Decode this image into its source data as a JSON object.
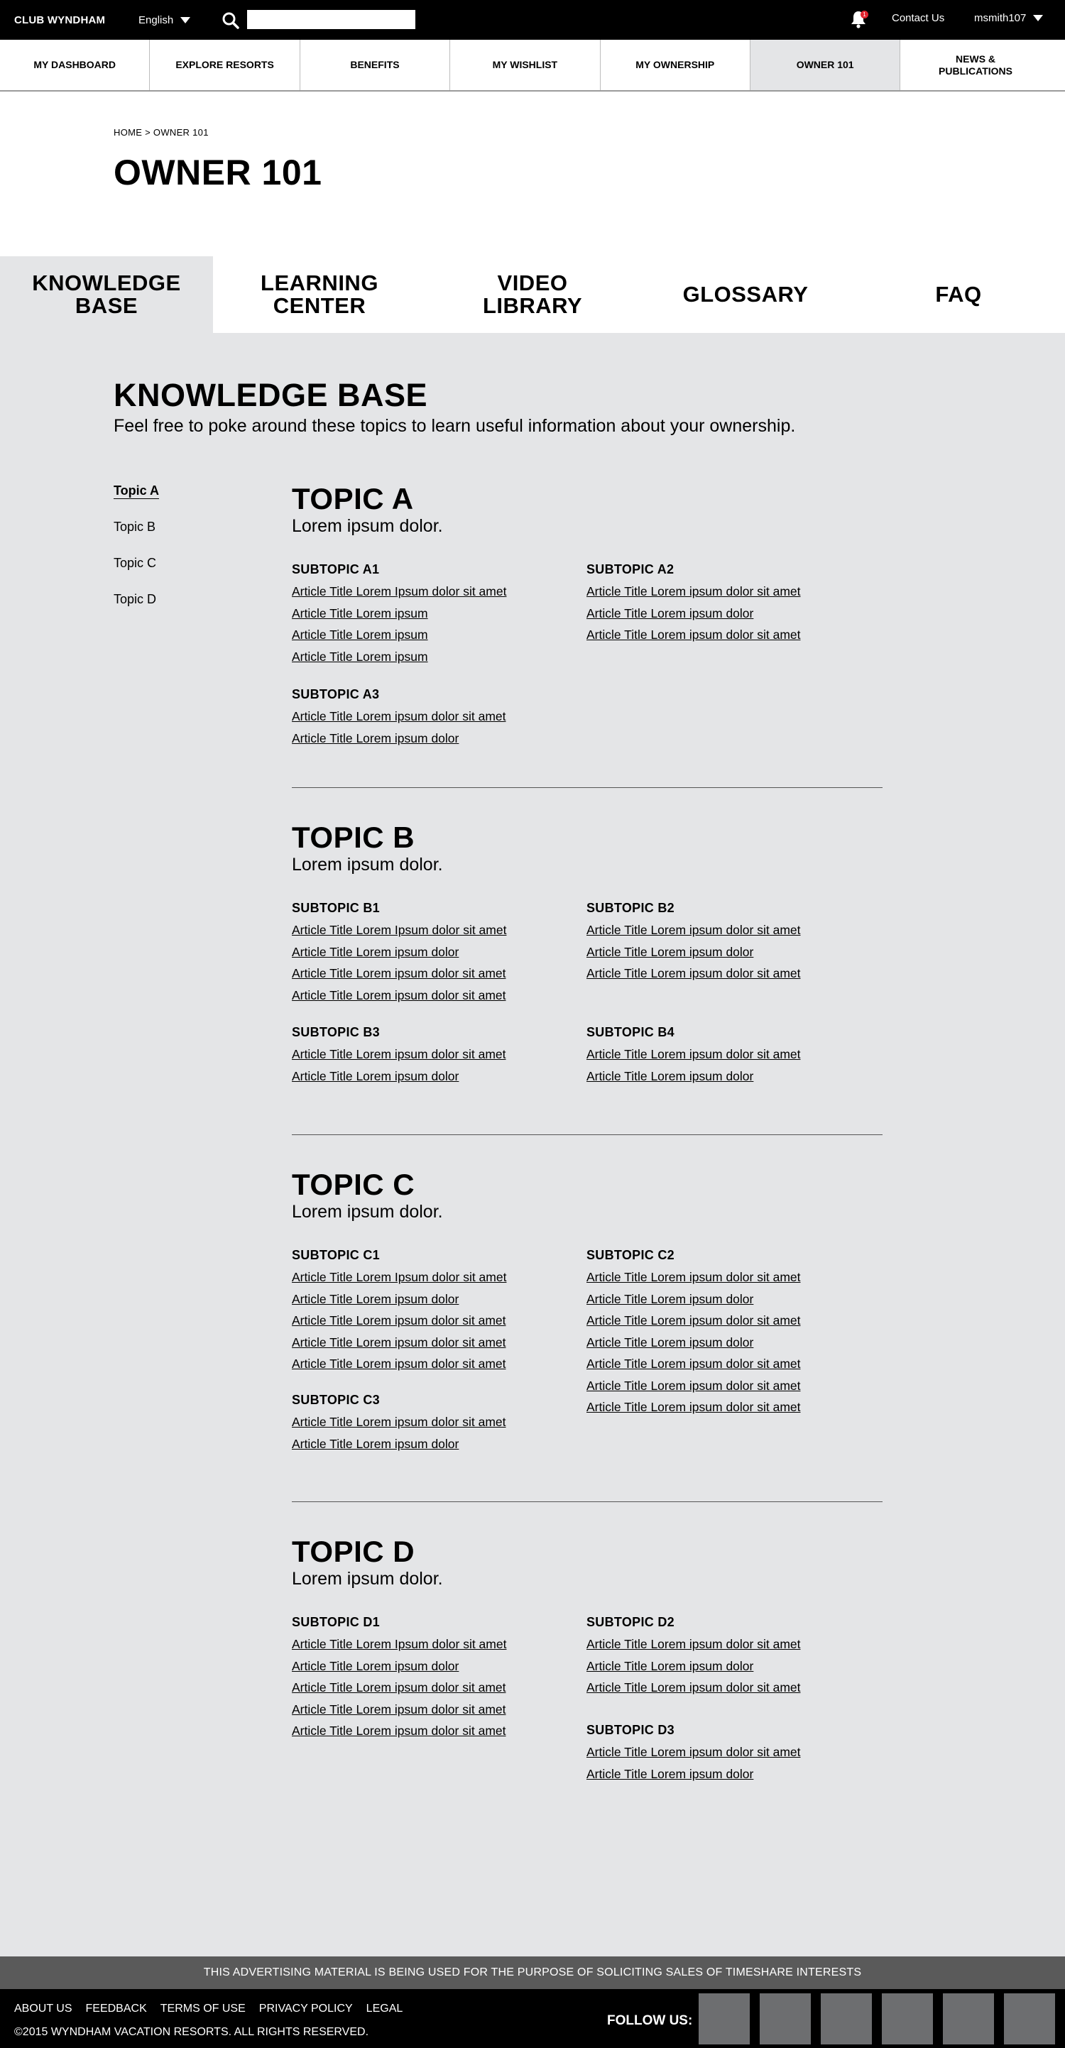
{
  "topbar": {
    "brand": "CLUB WYNDHAM",
    "language": "English",
    "search_placeholder": "",
    "notification_count": "1",
    "contact": "Contact Us",
    "username": "msmith107"
  },
  "mainnav": [
    {
      "label": "MY DASHBOARD"
    },
    {
      "label": "EXPLORE RESORTS"
    },
    {
      "label": "BENEFITS"
    },
    {
      "label": "MY WISHLIST"
    },
    {
      "label": "MY OWNERSHIP"
    },
    {
      "label": "OWNER 101"
    },
    {
      "label": "NEWS & PUBLICATIONS"
    }
  ],
  "breadcrumb": "HOME > OWNER 101",
  "page_title": "OWNER 101",
  "tabs": [
    {
      "label": "KNOWLEDGE BASE"
    },
    {
      "label": "LEARNING CENTER"
    },
    {
      "label": "VIDEO LIBRARY"
    },
    {
      "label": "GLOSSARY"
    },
    {
      "label": "FAQ"
    }
  ],
  "kb": {
    "title": "KNOWLEDGE BASE",
    "subtitle": "Feel free to poke around these topics to learn useful information about your ownership."
  },
  "sidenav": [
    "Topic A",
    "Topic B",
    "Topic C",
    "Topic D"
  ],
  "topics": [
    {
      "title": "TOPIC A",
      "subtitle": "Lorem ipsum dolor.",
      "subtopics": [
        {
          "title": "SUBTOPIC A1",
          "links": [
            "Article Title Lorem Ipsum dolor sit amet",
            "Article Title Lorem ipsum",
            "Article Title Lorem ipsum",
            "Article Title Lorem ipsum"
          ]
        },
        {
          "title": "SUBTOPIC A2",
          "links": [
            "Article Title Lorem ipsum dolor sit amet",
            "Article Title Lorem ipsum dolor",
            "Article Title Lorem ipsum dolor sit amet"
          ]
        },
        {
          "title": "SUBTOPIC A3",
          "links": [
            "Article Title Lorem ipsum dolor sit amet",
            "Article Title Lorem ipsum dolor"
          ]
        }
      ]
    },
    {
      "title": "TOPIC B",
      "subtitle": "Lorem ipsum dolor.",
      "subtopics": [
        {
          "title": "SUBTOPIC B1",
          "links": [
            "Article Title Lorem Ipsum dolor sit amet",
            "Article Title Lorem ipsum dolor",
            "Article Title Lorem ipsum dolor sit amet",
            "Article Title Lorem ipsum dolor sit amet"
          ]
        },
        {
          "title": "SUBTOPIC B2",
          "links": [
            "Article Title Lorem ipsum dolor sit amet",
            "Article Title Lorem ipsum dolor",
            "Article Title Lorem ipsum dolor sit amet"
          ]
        },
        {
          "title": "SUBTOPIC B3",
          "links": [
            "Article Title Lorem ipsum dolor sit amet",
            "Article Title Lorem ipsum dolor"
          ]
        },
        {
          "title": "SUBTOPIC B4",
          "links": [
            "Article Title Lorem ipsum dolor sit amet",
            "Article Title Lorem ipsum dolor"
          ]
        }
      ]
    },
    {
      "title": "TOPIC C",
      "subtitle": "Lorem ipsum dolor.",
      "subtopics": [
        {
          "title": "SUBTOPIC C1",
          "links": [
            "Article Title Lorem Ipsum dolor sit amet",
            "Article Title Lorem ipsum dolor",
            "Article Title Lorem ipsum dolor sit amet",
            "Article Title Lorem ipsum dolor sit amet",
            "Article Title Lorem ipsum dolor sit amet"
          ]
        },
        {
          "title": "SUBTOPIC C2",
          "links": [
            "Article Title Lorem ipsum dolor sit amet",
            "Article Title Lorem ipsum dolor",
            "Article Title Lorem ipsum dolor sit amet",
            "Article Title Lorem ipsum dolor",
            "Article Title Lorem ipsum dolor sit amet",
            "Article Title Lorem ipsum dolor sit amet",
            "Article Title Lorem ipsum dolor sit amet"
          ]
        },
        {
          "title": "SUBTOPIC C3",
          "links": [
            "Article Title Lorem ipsum dolor sit amet",
            "Article Title Lorem ipsum dolor"
          ]
        }
      ]
    },
    {
      "title": "TOPIC D",
      "subtitle": "Lorem ipsum dolor.",
      "subtopics": [
        {
          "title": "SUBTOPIC D1",
          "links": [
            "Article Title Lorem Ipsum dolor sit amet",
            "Article Title Lorem ipsum dolor",
            "Article Title Lorem ipsum dolor sit amet",
            "Article Title Lorem ipsum dolor sit amet",
            "Article Title Lorem ipsum dolor sit amet"
          ]
        },
        {
          "title": "SUBTOPIC D2",
          "links": [
            "Article Title Lorem ipsum dolor sit amet",
            "Article Title Lorem ipsum dolor",
            "Article Title Lorem ipsum dolor sit amet"
          ]
        },
        {
          "title": "SUBTOPIC D3",
          "links": [
            "Article Title Lorem ipsum dolor sit amet",
            "Article Title Lorem ipsum dolor"
          ]
        }
      ]
    }
  ],
  "footer": {
    "disclaimer": "THIS ADVERTISING MATERIAL IS BEING USED FOR THE PURPOSE OF SOLICITING SALES OF TIMESHARE INTERESTS",
    "links": [
      "ABOUT US",
      "FEEDBACK",
      "TERMS OF USE",
      "PRIVACY POLICY",
      "LEGAL"
    ],
    "copyright": "©2015 WYNDHAM VACATION RESORTS. ALL RIGHTS RESERVED.",
    "follow": "FOLLOW US:"
  }
}
